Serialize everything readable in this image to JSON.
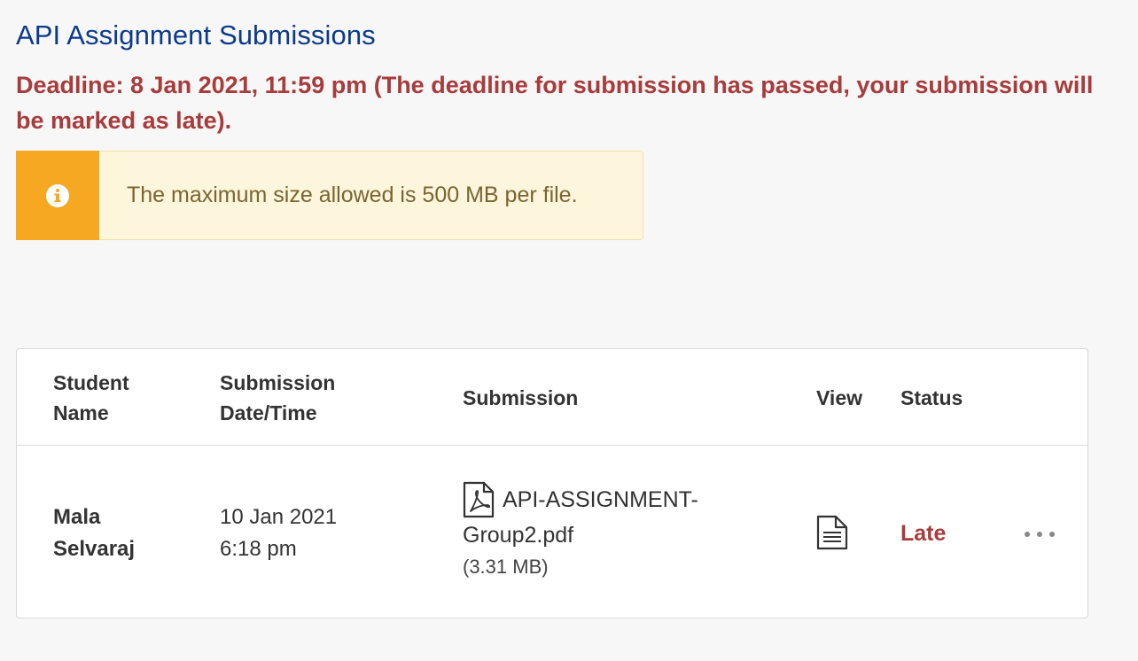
{
  "page": {
    "title": "API Assignment Submissions",
    "deadline": "Deadline: 8 Jan 2021, 11:59 pm (The deadline for submission has passed, your submission will be marked as late)."
  },
  "info": {
    "icon": "info-icon",
    "message": "The maximum size allowed is 500 MB per file."
  },
  "table": {
    "headers": {
      "student_name": "Student Name",
      "submission_datetime": "Submission Date/Time",
      "submission": "Submission",
      "view": "View",
      "status": "Status"
    },
    "rows": [
      {
        "student_first": "Mala",
        "student_last": "Selvaraj",
        "date": "10 Jan 2021",
        "time": "6:18 pm",
        "file_line1": "API-ASSIGNMENT-",
        "file_line2": "Group2.pdf",
        "file_size": "(3.31 MB)",
        "file_icon": "pdf-file-icon",
        "view_icon": "document-icon",
        "status": "Late",
        "more_icon": "more-options-icon"
      }
    ]
  },
  "colors": {
    "title": "#0b3a8a",
    "deadline": "#a83b3b",
    "info_accent": "#f7a823",
    "info_bg": "#fdf6dc",
    "status_late": "#a83b3b"
  }
}
